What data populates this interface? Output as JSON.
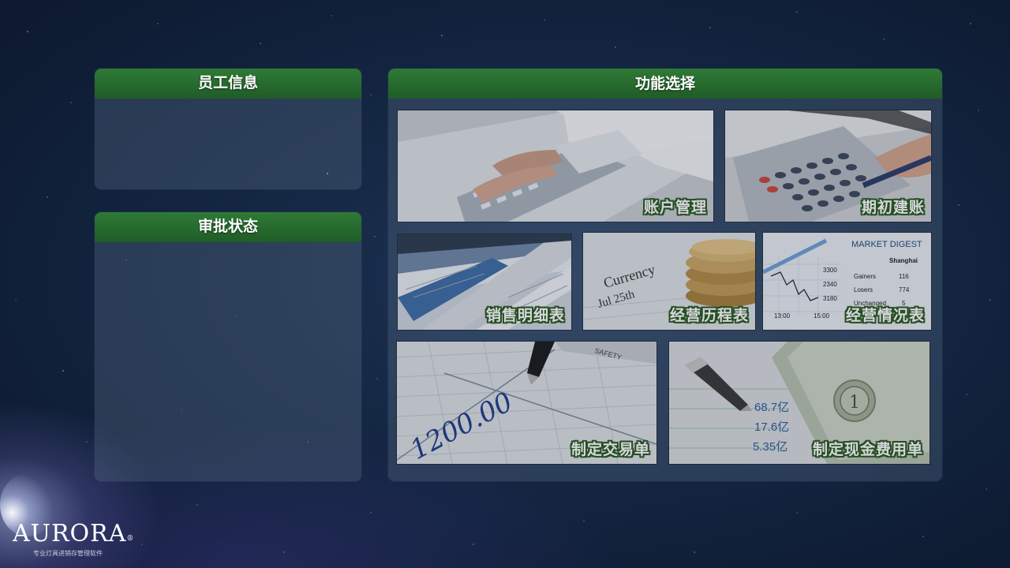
{
  "panels": {
    "employee_info": {
      "title": "员工信息"
    },
    "approval_status": {
      "title": "审批状态"
    },
    "function_select": {
      "title": "功能选择",
      "tiles": [
        {
          "label": "账户管理"
        },
        {
          "label": "期初建账"
        },
        {
          "label": "销售明细表"
        },
        {
          "label": "经营历程表"
        },
        {
          "label": "经营情况表"
        },
        {
          "label": "制定交易单"
        },
        {
          "label": "制定现金费用单"
        }
      ]
    }
  },
  "image_text": {
    "currency": "Currency",
    "date": "Jul 25th",
    "market_digest": "MARKET DIGEST",
    "shanghai": "Shanghai",
    "gainers": "Gainers",
    "gainers_val": "116",
    "losers": "Losers",
    "losers_val": "774",
    "unchanged": "Unchanged",
    "unchanged_val": "5",
    "chart_3300": "3300",
    "chart_3180": "3180",
    "chart_2340": "2340",
    "time_1300": "13:00",
    "time_1500": "15:00",
    "amount": "1200.00",
    "safety": "SAFETY",
    "yi1": "68.7亿",
    "yi2": "17.6亿",
    "yi3": "5.35亿"
  },
  "brand": {
    "name": "AURORA",
    "reg": "®",
    "tagline": "专业灯具进销存管理软件"
  }
}
